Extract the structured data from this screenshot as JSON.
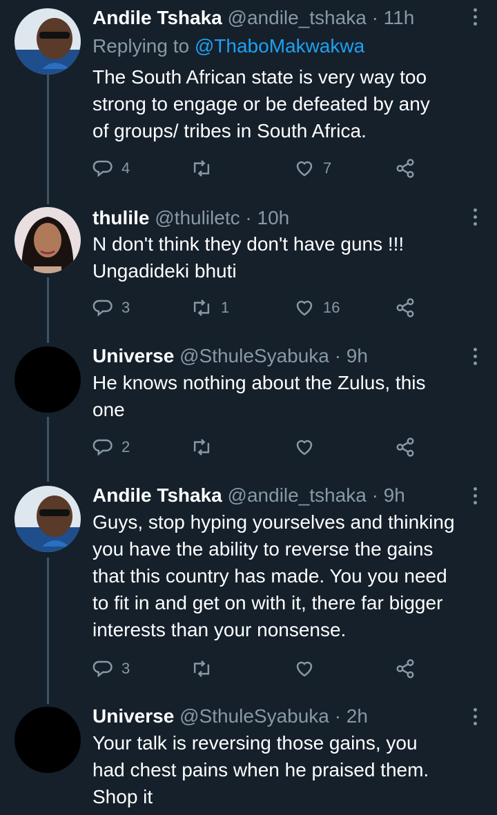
{
  "tweets": [
    {
      "name": "Andile Tshaka",
      "handle": "@andile_tshaka",
      "time": "11h",
      "reply_label": "Replying to",
      "reply_mention": "@ThaboMakwakwa",
      "lines": [
        "The South African state is very way too",
        "strong to engage or be defeated  by any",
        "of groups/ tribes in South Africa."
      ],
      "replies": "4",
      "retweets": "",
      "likes": "7",
      "avatar": "andile"
    },
    {
      "name": "thulile",
      "handle": "@thuliletc",
      "time": "10h",
      "lines": [
        "N don't think they don't have guns !!!",
        "Ungadideki  bhuti"
      ],
      "replies": "3",
      "retweets": "1",
      "likes": "16",
      "avatar": "thulile"
    },
    {
      "name": "Universe",
      "handle": "@SthuleSyabuka",
      "time": "9h",
      "lines": [
        "He knows nothing about the Zulus,  this",
        "one"
      ],
      "replies": "2",
      "retweets": "",
      "likes": "",
      "avatar": "universe"
    },
    {
      "name": "Andile Tshaka",
      "handle": "@andile_tshaka",
      "time": "9h",
      "lines": [
        "Guys, stop hyping yourselves and thinking",
        "you have the ability to reverse the gains",
        "that this country has made. You you need",
        "to fit in and get on with it, there far bigger",
        "interests than your nonsense."
      ],
      "replies": "3",
      "retweets": "",
      "likes": "",
      "avatar": "andile"
    },
    {
      "name": "Universe",
      "handle": "@SthuleSyabuka",
      "time": "2h",
      "lines": [
        "Your talk is reversing those gains, you",
        "had chest pains when he praised them.",
        "Shop it"
      ],
      "replies": "",
      "retweets": "",
      "likes": "",
      "avatar": "universe"
    }
  ],
  "separator": "·",
  "colors": {
    "background": "#15202b",
    "secondary_text": "#8899a6",
    "accent": "#1da1f2",
    "thread_line": "#3d5466"
  },
  "icons": {
    "reply": "reply-icon",
    "retweet": "retweet-icon",
    "like": "heart-icon",
    "share": "share-icon",
    "more": "more-vertical-icon"
  }
}
